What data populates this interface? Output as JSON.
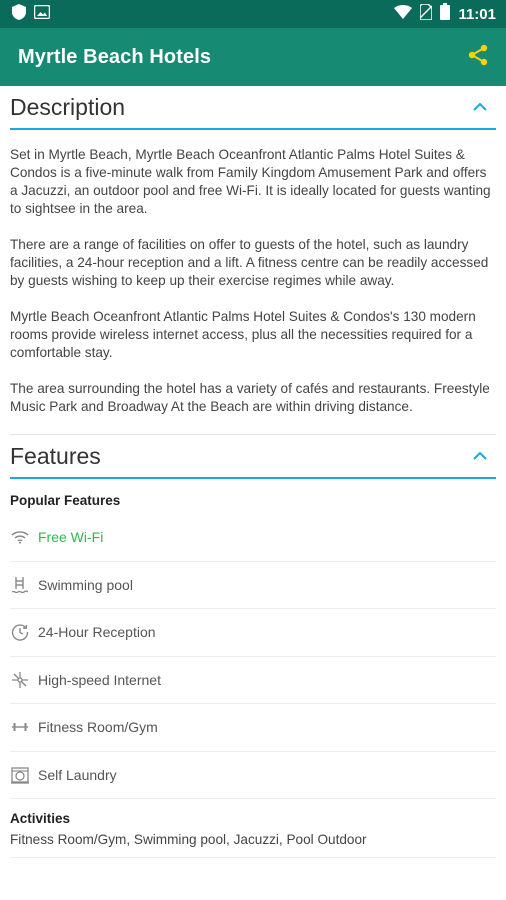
{
  "status_bar": {
    "time": "11:01",
    "icons": [
      "shield-icon",
      "image-icon",
      "wifi-icon",
      "no-sim-icon",
      "battery-icon"
    ]
  },
  "app_bar": {
    "title": "Myrtle Beach Hotels",
    "share_icon": "share-icon",
    "accent_color": "#f5d400"
  },
  "colors": {
    "status_bar": "#0b6b5a",
    "app_bar": "#168a73",
    "section_underline": "#1aa9df",
    "highlight_feature": "#2db84c"
  },
  "description": {
    "title": "Description",
    "paragraphs": [
      "Set in Myrtle Beach, Myrtle Beach Oceanfront Atlantic Palms Hotel Suites & Condos is a five-minute walk from Family Kingdom Amusement Park and offers a Jacuzzi, an outdoor pool and free Wi-Fi. It is ideally located for guests wanting to sightsee in the area.",
      "There are a range of facilities on offer to guests of the hotel, such as laundry facilities, a 24-hour reception and a lift. A fitness centre can be readily accessed by guests wishing to keep up their exercise regimes while away.",
      "Myrtle Beach Oceanfront Atlantic Palms Hotel Suites & Condos's 130 modern rooms provide wireless internet access, plus all the necessities required for a comfortable stay.",
      "The area surrounding the hotel has a variety of cafés and restaurants. Freestyle Music Park and Broadway At the Beach are within driving distance."
    ]
  },
  "features": {
    "title": "Features",
    "popular_title": "Popular Features",
    "items": [
      {
        "label": "Free Wi-Fi",
        "icon": "wifi-icon"
      },
      {
        "label": "Swimming pool",
        "icon": "pool-icon"
      },
      {
        "label": "24-Hour Reception",
        "icon": "clock-icon"
      },
      {
        "label": "High-speed Internet",
        "icon": "network-icon"
      },
      {
        "label": "Fitness Room/Gym",
        "icon": "dumbbell-icon"
      },
      {
        "label": "Self Laundry",
        "icon": "laundry-icon"
      }
    ],
    "activities_title": "Activities",
    "activities_text": "Fitness Room/Gym, Swimming pool, Jacuzzi, Pool Outdoor"
  }
}
